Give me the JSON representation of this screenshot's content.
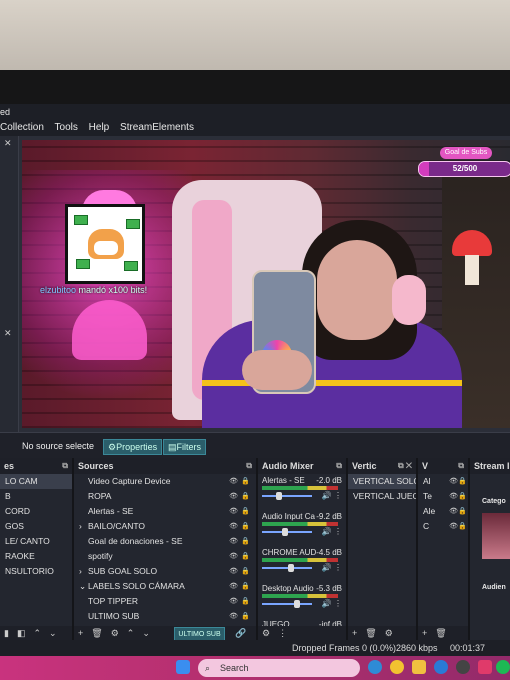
{
  "window": {
    "title_fragment": "ed"
  },
  "menu": [
    "Collection",
    "Tools",
    "Help",
    "StreamElements"
  ],
  "preview": {
    "alert_user": "elzubitoo",
    "alert_text": " mandó x100 bits!",
    "goal": {
      "title": "Goal de Subs",
      "value": "52/500",
      "current": 52,
      "target": 500
    }
  },
  "source_bar": {
    "no_source": "No source selecte",
    "properties": "Properties",
    "filters": "Filters"
  },
  "scenes": {
    "title": "es",
    "items": [
      "LO CAM",
      "B",
      "CORD",
      "GOS",
      "LE/ CANTO",
      "RAOKE",
      "NSULTORIO"
    ]
  },
  "sources": {
    "title": "Sources",
    "items": [
      {
        "label": "Video Capture Device",
        "prefix": ""
      },
      {
        "label": "ROPA",
        "prefix": ""
      },
      {
        "label": "Alertas - SE",
        "prefix": ""
      },
      {
        "label": "BAILO/CANTO",
        "prefix": "›"
      },
      {
        "label": "Goal de donaciones - SE",
        "prefix": ""
      },
      {
        "label": "spotify",
        "prefix": ""
      },
      {
        "label": "SUB GOAL SOLO",
        "prefix": "›"
      },
      {
        "label": "LABELS SOLO CÁMARA",
        "prefix": "⌄"
      },
      {
        "label": "TOP TIPPER",
        "prefix": ""
      },
      {
        "label": "ULTIMO SUB",
        "prefix": ""
      }
    ],
    "badge": "ULTIMO SUB"
  },
  "mixer": {
    "title": "Audio Mixer",
    "items": [
      {
        "name": "Alertas - SE",
        "db": "-2.0 dB"
      },
      {
        "name": "Audio Input Ca",
        "db": "-9.2 dB"
      },
      {
        "name": "CHROME AUD",
        "db": "-4.5 dB"
      },
      {
        "name": "Desktop Audio",
        "db": "-5.3 dB"
      },
      {
        "name": "JUEGO",
        "db": "-inf dB"
      }
    ]
  },
  "vertical_scenes": {
    "title": "Vertic",
    "items": [
      "VERTICAL SOLO C",
      "VERTICAL JUEGOS"
    ]
  },
  "vertical_sources": {
    "title": "V",
    "items": [
      "Al",
      "Te",
      "Ale",
      "C"
    ]
  },
  "stream": {
    "title": "Stream I",
    "category": "Catego",
    "audience": "Audien"
  },
  "status": {
    "dropped": "Dropped Frames 0 (0.0%)",
    "kbps": "2860 kbps",
    "time": "00:01:37"
  },
  "taskbar": {
    "search": "Search"
  },
  "colors": {
    "accent": "#d33cbd",
    "taskbar": "#c9337e",
    "obs_bg": "#23262f"
  }
}
